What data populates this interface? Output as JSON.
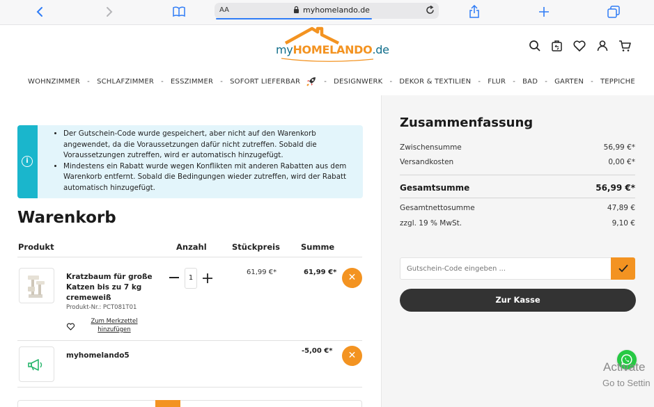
{
  "browser": {
    "aa_label": "AA",
    "url": "myhomelando.de"
  },
  "logo": {
    "part1": "my",
    "part2": "HOMELANDO",
    "part3": ".de"
  },
  "nav": {
    "items": [
      "WOHNZIMMER",
      "SCHLAFZIMMER",
      "ESSZIMMER",
      "SOFORT LIEFERBAR",
      "DESIGNWERK",
      "DEKOR & TEXTILIEN",
      "FLUR",
      "BAD",
      "GARTEN",
      "TEPPICHE"
    ],
    "separator": "-"
  },
  "alert": {
    "messages": [
      "Der Gutschein-Code wurde gespeichert, aber nicht auf den Warenkorb angewendet, da die Voraussetzungen dafür nicht zutreffen. Sobald die Voraussetzungen zutreffen, wird er automatisch hinzugefügt.",
      "Mindestens ein Rabatt wurde wegen Konflikten mit anderen Rabatten aus dem Warenkorb entfernt. Sobald die Bedingungen wieder zutreffen, wird der Rabatt automatisch hinzugefügt."
    ],
    "icon": "info-icon"
  },
  "cart": {
    "title": "Warenkorb",
    "columns": {
      "product": "Produkt",
      "qty": "Anzahl",
      "unit": "Stückpreis",
      "total": "Summe"
    },
    "items": [
      {
        "name": "Kratzbaum für große Katzen bis zu 7 kg cremeweiß",
        "product_no": "Produkt-Nr.: PCT081T01",
        "wishlist": "Zum Merkzettel hinzufügen",
        "qty": "1",
        "unit_price": "61,99 €*",
        "total": "61,99 €*"
      },
      {
        "name": "myhomelando5",
        "total": "-5,00 €*"
      }
    ]
  },
  "summary": {
    "title": "Zusammenfassung",
    "subtotal_label": "Zwischensumme",
    "subtotal": "56,99 €*",
    "shipping_label": "Versandkosten",
    "shipping": "0,00 €*",
    "total_label": "Gesamtsumme",
    "total": "56,99 €*",
    "net_label": "Gesamtnettosumme",
    "net": "47,89 €",
    "vat_label": "zzgl. 19 % MwSt.",
    "vat": "9,10 €",
    "coupon_placeholder": "Gutschein-Code eingeben ...",
    "checkout_label": "Zur Kasse"
  },
  "overlay": {
    "activate": "Activate",
    "goto": "Go to Settin"
  },
  "colors": {
    "accent": "#f39321",
    "brand_blue": "#0f6d8a",
    "alert_stripe": "#1ab6cc",
    "dark_button": "#333333"
  }
}
